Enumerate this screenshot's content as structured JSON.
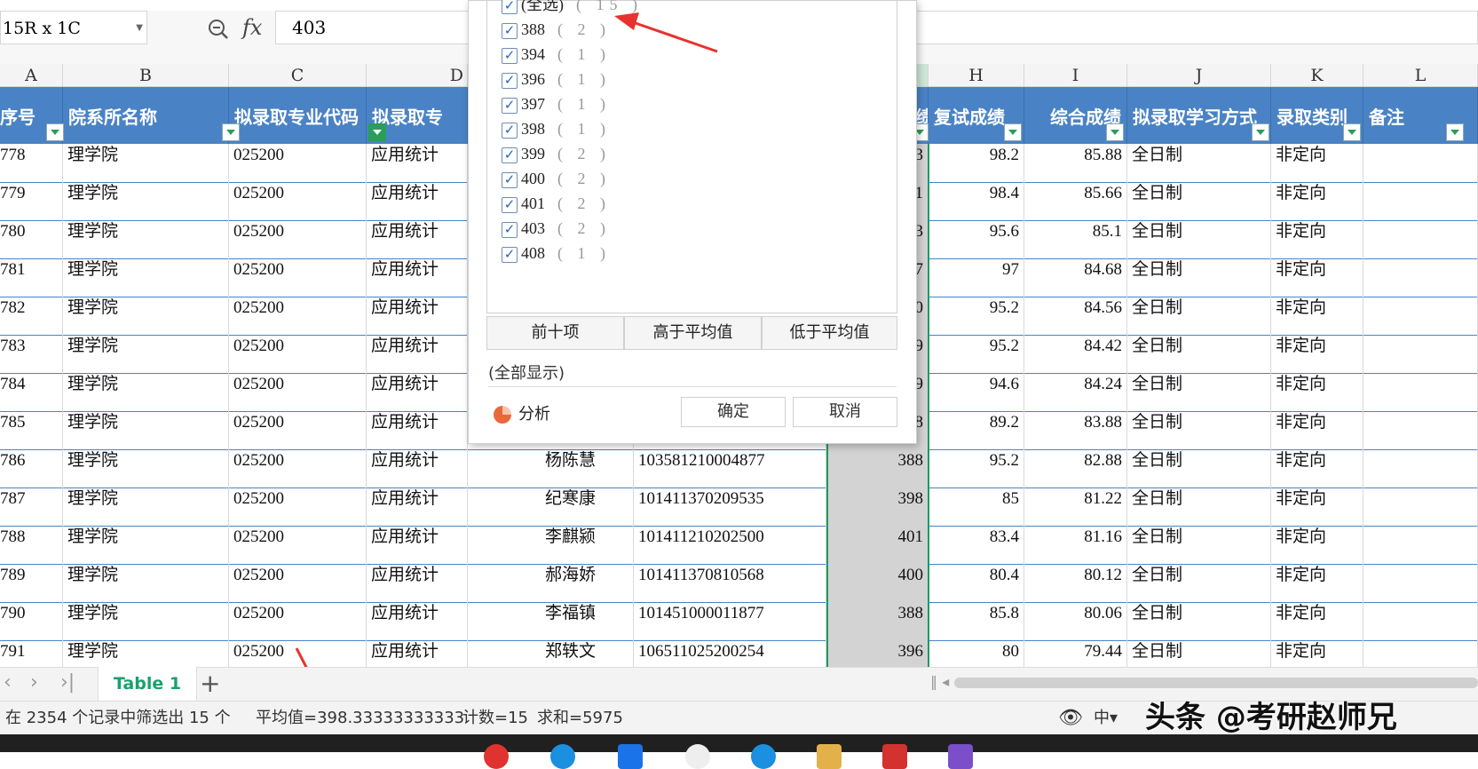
{
  "name_box": "15R x 1C",
  "formula_label": "fx",
  "formula_value": "403",
  "columns": [
    "A",
    "B",
    "C",
    "D",
    "H",
    "I",
    "J",
    "K",
    "L"
  ],
  "headers": [
    "序号",
    "院系所名称",
    "拟录取专业代码",
    "拟录取专",
    "绩",
    "复试成绩",
    "综合成绩",
    "拟录取学习方式",
    "录取类别",
    "备注"
  ],
  "rows": [
    {
      "seq": "778",
      "dept": "理学院",
      "code": "025200",
      "major": "应用统计",
      "name": "",
      "id": "",
      "score": "03",
      "retest": "98.2",
      "total": "85.88",
      "mode": "全日制",
      "type": "非定向"
    },
    {
      "seq": "779",
      "dept": "理学院",
      "code": "025200",
      "major": "应用统计",
      "name": "",
      "id": "",
      "score": "01",
      "retest": "98.4",
      "total": "85.66",
      "mode": "全日制",
      "type": "非定向"
    },
    {
      "seq": "780",
      "dept": "理学院",
      "code": "025200",
      "major": "应用统计",
      "name": "",
      "id": "",
      "score": "03",
      "retest": "95.6",
      "total": "85.1",
      "mode": "全日制",
      "type": "非定向"
    },
    {
      "seq": "781",
      "dept": "理学院",
      "code": "025200",
      "major": "应用统计",
      "name": "",
      "id": "",
      "score": "97",
      "retest": "97",
      "total": "84.68",
      "mode": "全日制",
      "type": "非定向"
    },
    {
      "seq": "782",
      "dept": "理学院",
      "code": "025200",
      "major": "应用统计",
      "name": "",
      "id": "",
      "score": "00",
      "retest": "95.2",
      "total": "84.56",
      "mode": "全日制",
      "type": "非定向"
    },
    {
      "seq": "783",
      "dept": "理学院",
      "code": "025200",
      "major": "应用统计",
      "name": "",
      "id": "",
      "score": "99",
      "retest": "95.2",
      "total": "84.42",
      "mode": "全日制",
      "type": "非定向"
    },
    {
      "seq": "784",
      "dept": "理学院",
      "code": "025200",
      "major": "应用统计",
      "name": "",
      "id": "",
      "score": "99",
      "retest": "94.6",
      "total": "84.24",
      "mode": "全日制",
      "type": "非定向"
    },
    {
      "seq": "785",
      "dept": "理学院",
      "code": "025200",
      "major": "应用统计",
      "name": "",
      "id": "",
      "score": "08",
      "retest": "89.2",
      "total": "83.88",
      "mode": "全日制",
      "type": "非定向"
    },
    {
      "seq": "786",
      "dept": "理学院",
      "code": "025200",
      "major": "应用统计",
      "name": "杨陈慧",
      "id": "103581210004877",
      "score": "388",
      "retest": "95.2",
      "total": "82.88",
      "mode": "全日制",
      "type": "非定向"
    },
    {
      "seq": "787",
      "dept": "理学院",
      "code": "025200",
      "major": "应用统计",
      "name": "纪寒康",
      "id": "101411370209535",
      "score": "398",
      "retest": "85",
      "total": "81.22",
      "mode": "全日制",
      "type": "非定向"
    },
    {
      "seq": "788",
      "dept": "理学院",
      "code": "025200",
      "major": "应用统计",
      "name": "李麒颍",
      "id": "101411210202500",
      "score": "401",
      "retest": "83.4",
      "total": "81.16",
      "mode": "全日制",
      "type": "非定向"
    },
    {
      "seq": "789",
      "dept": "理学院",
      "code": "025200",
      "major": "应用统计",
      "name": "郝海娇",
      "id": "101411370810568",
      "score": "400",
      "retest": "80.4",
      "total": "80.12",
      "mode": "全日制",
      "type": "非定向"
    },
    {
      "seq": "790",
      "dept": "理学院",
      "code": "025200",
      "major": "应用统计",
      "name": "李福镇",
      "id": "101451000011877",
      "score": "388",
      "retest": "85.8",
      "total": "80.06",
      "mode": "全日制",
      "type": "非定向"
    },
    {
      "seq": "791",
      "dept": "理学院",
      "code": "025200",
      "major": "应用统计",
      "name": "郑轶文",
      "id": "106511025200254",
      "score": "396",
      "retest": "80",
      "total": "79.44",
      "mode": "全日制",
      "type": "非定向"
    }
  ],
  "filter_popup": {
    "items": [
      {
        "label": "(全选)",
        "count": "( 15 )"
      },
      {
        "label": "388",
        "count": "( 2 )"
      },
      {
        "label": "394",
        "count": "( 1 )"
      },
      {
        "label": "396",
        "count": "( 1 )"
      },
      {
        "label": "397",
        "count": "( 1 )"
      },
      {
        "label": "398",
        "count": "( 1 )"
      },
      {
        "label": "399",
        "count": "( 2 )"
      },
      {
        "label": "400",
        "count": "( 2 )"
      },
      {
        "label": "401",
        "count": "( 2 )"
      },
      {
        "label": "403",
        "count": "( 2 )"
      },
      {
        "label": "408",
        "count": "( 1 )"
      }
    ],
    "tabs": [
      "前十项",
      "高于平均值",
      "低于平均值"
    ],
    "show_all": "(全部显示)",
    "analysis": "分析",
    "ok": "确定",
    "cancel": "取消"
  },
  "sheet_tab": "Table 1",
  "status": {
    "filter_info": "在 2354 个记录中筛选出 15 个",
    "average": "平均值=398.33333333333",
    "count": "计数=15",
    "sum": "求和=5975"
  },
  "watermark": "头条 @考研赵师兄",
  "colors": {
    "header_bg": "#4a83c5",
    "active_tab": "#1aa06d",
    "selection": "#d3d3d3",
    "arrow": "#e8322f"
  }
}
